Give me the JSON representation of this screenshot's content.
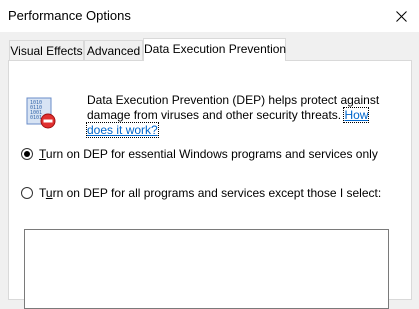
{
  "window": {
    "title": "Performance Options",
    "close_icon": "close-icon"
  },
  "tabs": [
    {
      "label": "Visual Effects",
      "active": false
    },
    {
      "label": "Advanced",
      "active": false
    },
    {
      "label": "Data Execution Prevention",
      "active": true
    }
  ],
  "dep": {
    "icon": "dep-shield-icon",
    "description_line1": "Data Execution Prevention (DEP) helps protect against",
    "description_line2_prefix": "damage from viruses and other security threats. ",
    "link_part1": "How",
    "link_part2": "does it work?",
    "options": [
      {
        "label_first_letter": "T",
        "label_rest": "urn on DEP for essential Windows programs and services only",
        "selected": true
      },
      {
        "label_first_letter": "",
        "label_prefix": "T",
        "label_underlined": "u",
        "label_rest": "rn on DEP for all programs and services except those I select:",
        "selected": false
      }
    ]
  },
  "colors": {
    "link": "#0066cc",
    "window_bg": "#f0f0f0",
    "panel_bg": "#ffffff"
  }
}
